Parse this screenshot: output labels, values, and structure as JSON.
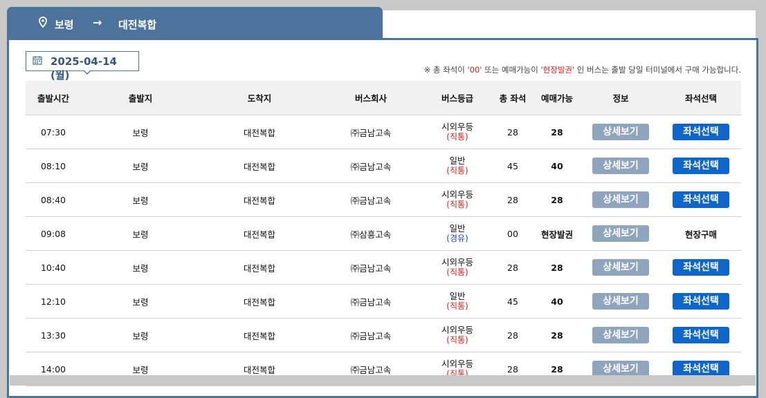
{
  "route": {
    "departure": "보령",
    "arrow": "→",
    "arrival": "대전복합"
  },
  "date": "2025-04-14 (월)",
  "notice": {
    "prefix": "※ 총 좌석이 '",
    "highlight1": "00",
    "middle": "' 또는 예매가능이 '",
    "highlight2": "현장발권",
    "suffix": "' 인 버스는 출발 당일 터미널에서 구매 가능합니다."
  },
  "columns": [
    "출발시간",
    "출발지",
    "도착지",
    "버스회사",
    "버스등급",
    "총 좌석",
    "예매가능",
    "정보",
    "좌석선택"
  ],
  "rows": [
    {
      "time": "07:30",
      "from": "보령",
      "to": "대전복합",
      "company": "㈜금남고속",
      "grade": "시외우등",
      "route_type": "(직통)",
      "route_kind": "direct",
      "total": "28",
      "available": "28",
      "detail": "상세보기",
      "select": "좌석선택"
    },
    {
      "time": "08:10",
      "from": "보령",
      "to": "대전복합",
      "company": "㈜금남고속",
      "grade": "일반",
      "route_type": "(직통)",
      "route_kind": "direct",
      "total": "45",
      "available": "40",
      "detail": "상세보기",
      "select": "좌석선택"
    },
    {
      "time": "08:40",
      "from": "보령",
      "to": "대전복합",
      "company": "㈜금남고속",
      "grade": "시외우등",
      "route_type": "(직통)",
      "route_kind": "direct",
      "total": "28",
      "available": "28",
      "detail": "상세보기",
      "select": "좌석선택"
    },
    {
      "time": "09:08",
      "from": "보령",
      "to": "대전복합",
      "company": "㈜삼흥고속",
      "grade": "일반",
      "route_type": "(경유)",
      "route_kind": "via",
      "total": "00",
      "available": "현장발권",
      "detail": "상세보기",
      "select": "현장구매"
    },
    {
      "time": "10:40",
      "from": "보령",
      "to": "대전복합",
      "company": "㈜금남고속",
      "grade": "시외우등",
      "route_type": "(직통)",
      "route_kind": "direct",
      "total": "28",
      "available": "28",
      "detail": "상세보기",
      "select": "좌석선택"
    },
    {
      "time": "12:10",
      "from": "보령",
      "to": "대전복합",
      "company": "㈜금남고속",
      "grade": "일반",
      "route_type": "(직통)",
      "route_kind": "direct",
      "total": "45",
      "available": "40",
      "detail": "상세보기",
      "select": "좌석선택"
    },
    {
      "time": "13:30",
      "from": "보령",
      "to": "대전복합",
      "company": "㈜금남고속",
      "grade": "시외우등",
      "route_type": "(직통)",
      "route_kind": "direct",
      "total": "28",
      "available": "28",
      "detail": "상세보기",
      "select": "좌석선택"
    },
    {
      "time": "14:00",
      "from": "보령",
      "to": "대전복합",
      "company": "㈜금남고속",
      "grade": "시외우등",
      "route_type": "(직통)",
      "route_kind": "direct",
      "total": "28",
      "available": "28",
      "detail": "상세보기",
      "select": "좌석선택"
    }
  ],
  "icons": {
    "pin": "map-pin-icon",
    "arrow": "arrow-right-icon",
    "calendar": "calendar-icon"
  },
  "colors": {
    "header_blue": "#4b739b",
    "detail_button": "#8ea5bd",
    "select_button": "#0f66c9",
    "direct_red": "#e31b1b",
    "via_blue": "#1b3fc4"
  }
}
